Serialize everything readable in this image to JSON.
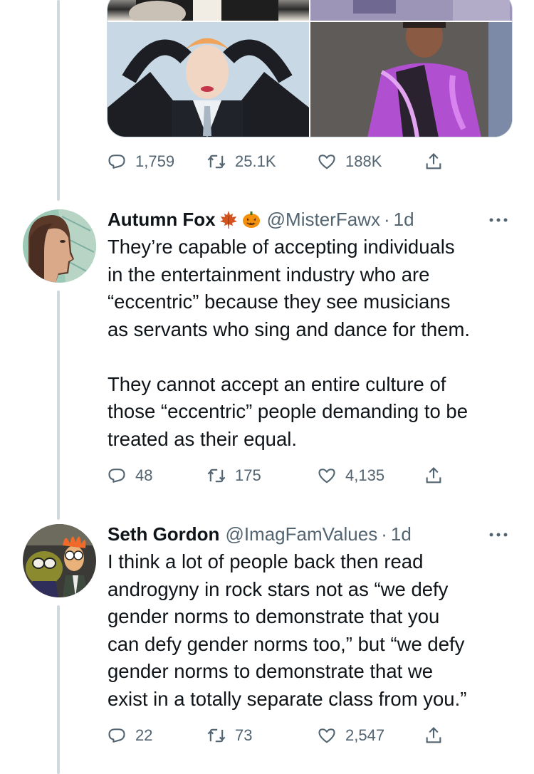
{
  "top_tweet": {
    "actions": {
      "replies": "1,759",
      "retweets": "25.1K",
      "likes": "188K"
    }
  },
  "tweets": [
    {
      "author": "Autumn Fox",
      "emojis": [
        "maple-leaf-icon",
        "jack-o-lantern-icon"
      ],
      "handle": "@MisterFawx",
      "age": "1d",
      "text": "They’re capable of accepting individuals\nin the entertainment industry who are\n“eccentric” because they see musicians\nas servants who sing and dance for them.\n\nThey cannot accept an entire culture of\nthose “eccentric” people demanding to be\ntreated as their equal.",
      "actions": {
        "replies": "48",
        "retweets": "175",
        "likes": "4,135"
      }
    },
    {
      "author": "Seth Gordon",
      "handle": "@ImagFamValues",
      "age": "1d",
      "text": "I think a lot of people back then read\nandrogyny in rock stars not as “we defy\ngender norms to demonstrate that you\ncan defy gender norms too,” but “we defy\ngender norms to demonstrate that we\nexist in a totally separate class from you.”",
      "actions": {
        "replies": "22",
        "retweets": "73",
        "likes": "2,547"
      }
    }
  ],
  "colors": {
    "text": "#0f1419",
    "secondary": "#536471",
    "thread_line": "#cfd9de"
  }
}
